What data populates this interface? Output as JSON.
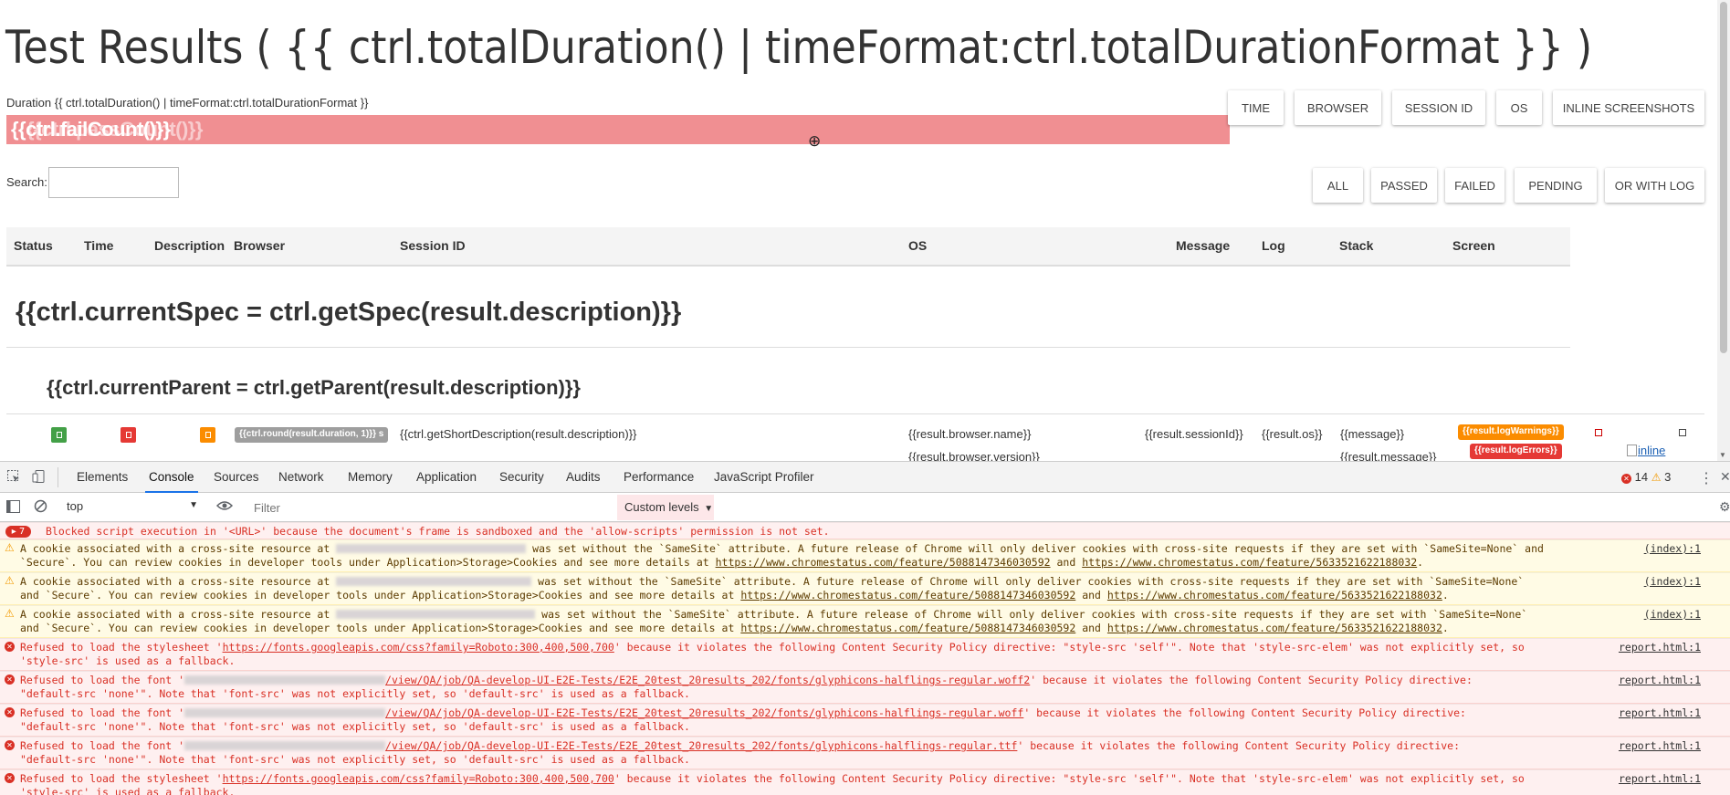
{
  "report": {
    "title": "Test Results ( {{ ctrl.totalDuration() | timeFormat:ctrl.totalDurationFormat }} )",
    "duration": "Duration {{ ctrl.totalDuration() | timeFormat:ctrl.totalDurationFormat }}",
    "progress_text_a": "{{ctrl.failCount()}}",
    "progress_text_b": "{{ctrl.passCount()}}",
    "column_buttons": [
      "TIME",
      "BROWSER",
      "SESSION ID",
      "OS",
      "INLINE SCREENSHOTS"
    ],
    "filter_buttons": [
      "ALL",
      "PASSED",
      "FAILED",
      "PENDING",
      "OR WITH LOG"
    ],
    "search_label": "Search:",
    "search_value": "",
    "headers": [
      "Status",
      "Time",
      "Description",
      "Browser",
      "Session ID",
      "OS",
      "Message",
      "Log",
      "Stack",
      "Screen"
    ],
    "spec_title": "{{ctrl.currentSpec = ctrl.getSpec(result.description)}}",
    "parent_title": "{{ctrl.currentParent = ctrl.getParent(result.description)}}",
    "row": {
      "duration_pill": "{{ctrl.round(result.duration, 1)}} s",
      "description": "{{ctrl.getShortDescription(result.description)}}",
      "browser_name": "{{result.browser.name}}",
      "browser_version": "{{result.browser.version}}",
      "session_id": "{{result.sessionId}}",
      "os": "{{result.os}}",
      "message_1": "{{message}}",
      "message_2": "{{result.message}}",
      "log_warnings": "{{result.logWarnings}}",
      "log_errors": "{{result.logErrors}}",
      "screenshot_alt": "inline"
    },
    "colors": {
      "progress": "#f08f92",
      "passed": "#43a047",
      "failed": "#e53935",
      "pending": "#fb8c00"
    }
  },
  "devtools": {
    "tabs": [
      "Elements",
      "Console",
      "Sources",
      "Network",
      "Memory",
      "Application",
      "Security",
      "Audits",
      "Performance",
      "JavaScript Profiler"
    ],
    "active_tab": "Console",
    "error_count": "14",
    "warning_count": "3",
    "context": "top",
    "filter_placeholder": "Filter",
    "levels": "Custom levels",
    "messages": [
      {
        "type": "error-group",
        "badge": "7",
        "line1": "Blocked script execution in '<URL>' because the document's frame is sandboxed and the 'allow-scripts' permission is not set."
      },
      {
        "type": "warn",
        "pre": "A cookie associated with a cross-site resource at",
        "post": "was set without the `SameSite` attribute. A future release of Chrome will only deliver cookies with cross-site requests if they are set with `SameSite=None` and",
        "line2a": "`Secure`. You can review cookies in developer tools under Application>Storage>Cookies and see more details at",
        "url1": "https://www.chromestatus.com/feature/5088147346030592",
        "and": "and",
        "url2": "https://www.chromestatus.com/feature/5633521622188032",
        "dot": ".",
        "source": "(index):1"
      },
      {
        "type": "warn",
        "pre": "A cookie associated with a cross-site resource at",
        "post": "was set without the `SameSite` attribute. A future release of Chrome will only deliver cookies with cross-site requests if they are set with `SameSite=None`",
        "line2a": "and `Secure`. You can review cookies in developer tools under Application>Storage>Cookies and see more details at",
        "url1": "https://www.chromestatus.com/feature/5088147346030592",
        "and": "and",
        "url2": "https://www.chromestatus.com/feature/5633521622188032",
        "dot": ".",
        "source": "(index):1"
      },
      {
        "type": "warn",
        "pre": "A cookie associated with a cross-site resource at",
        "post": "was set without the `SameSite` attribute. A future release of Chrome will only deliver cookies with cross-site requests if they are set with `SameSite=None`",
        "line2a": "and `Secure`. You can review cookies in developer tools under Application>Storage>Cookies and see more details at",
        "url1": "https://www.chromestatus.com/feature/5088147346030592",
        "and": "and",
        "url2": "https://www.chromestatus.com/feature/5633521622188032",
        "dot": ".",
        "source": "(index):1"
      },
      {
        "type": "error",
        "pre": "Refused to load the stylesheet '",
        "link": "https://fonts.googleapis.com/css?family=Roboto:300,400,500,700",
        "post": "' because it violates the following Content Security Policy directive: \"style-src 'self'\". Note that 'style-src-elem' was not explicitly set, so",
        "line2": "'style-src' is used as a fallback.",
        "source": "report.html:1"
      },
      {
        "type": "error",
        "pre": "Refused to load the font '",
        "link": "/view/QA/job/QA-develop-UI-E2E-Tests/E2E_20test_20results_202/fonts/glyphicons-halflings-regular.woff2",
        "post": "' because it violates the following Content Security Policy directive:",
        "line2": "\"default-src 'none'\". Note that 'font-src' was not explicitly set, so 'default-src' is used as a fallback.",
        "source": "report.html:1"
      },
      {
        "type": "error",
        "pre": "Refused to load the font '",
        "link": "/view/QA/job/QA-develop-UI-E2E-Tests/E2E_20test_20results_202/fonts/glyphicons-halflings-regular.woff",
        "post": "' because it violates the following Content Security Policy directive:",
        "line2": "\"default-src 'none'\". Note that 'font-src' was not explicitly set, so 'default-src' is used as a fallback.",
        "source": "report.html:1"
      },
      {
        "type": "error",
        "pre": "Refused to load the font '",
        "link": "/view/QA/job/QA-develop-UI-E2E-Tests/E2E_20test_20results_202/fonts/glyphicons-halflings-regular.ttf",
        "post": "' because it violates the following Content Security Policy directive:",
        "line2": "\"default-src 'none'\". Note that 'font-src' was not explicitly set, so 'default-src' is used as a fallback.",
        "source": "report.html:1"
      },
      {
        "type": "error",
        "pre": "Refused to load the stylesheet '",
        "link": "https://fonts.googleapis.com/css?family=Roboto:300,400,500,700",
        "post": "' because it violates the following Content Security Policy directive: \"style-src 'self'\". Note that 'style-src-elem' was not explicitly set, so",
        "line2": "'style-src' is used as a fallback.",
        "source": "report.html:1"
      }
    ]
  }
}
